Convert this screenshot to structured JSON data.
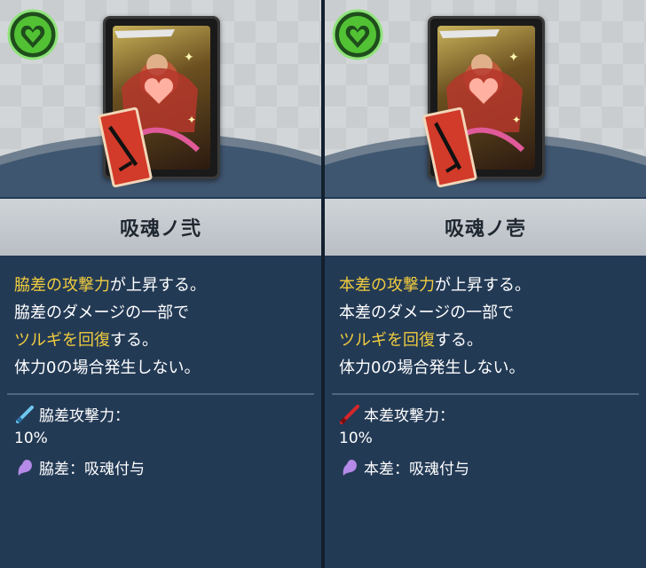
{
  "cards": [
    {
      "name": "吸魂ノ弐",
      "desc": {
        "line1_hl": "脇差の攻撃力",
        "line1_rest": "が上昇する。",
        "line2": "脇差のダメージの一部で",
        "line3_hl": "ツルギを回復",
        "line3_rest": "する。",
        "line4": "体力0の場合発生しない。"
      },
      "stat_label": "脇差攻撃力：",
      "stat_value": "10%",
      "effect": "脇差：吸魂付与",
      "weapon_icon": "blue-wakizashi-icon",
      "effect_icon": "soul-icon"
    },
    {
      "name": "吸魂ノ壱",
      "desc": {
        "line1_hl": "本差の攻撃力",
        "line1_rest": "が上昇する。",
        "line2": "本差のダメージの一部で",
        "line3_hl": "ツルギを回復",
        "line3_rest": "する。",
        "line4": "体力0の場合発生しない。"
      },
      "stat_label": "本差攻撃力：",
      "stat_value": "10%",
      "effect": "本差：吸魂付与",
      "weapon_icon": "red-honzashi-icon",
      "effect_icon": "soul-icon"
    }
  ],
  "colors": {
    "highlight": "#f0cc3e",
    "panel_bg": "#233a55",
    "attribute_green": "#52c234"
  }
}
